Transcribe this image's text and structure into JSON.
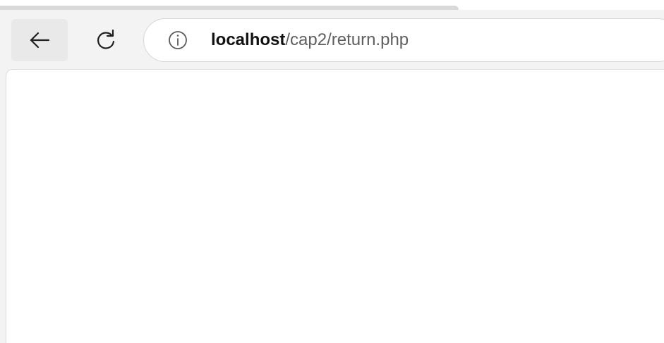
{
  "browser": {
    "nav": {
      "back_icon": "back-arrow-icon",
      "reload_icon": "reload-icon"
    },
    "address_bar": {
      "site_info_icon": "info-icon",
      "url_host": "localhost",
      "url_path": "/cap2/return.php"
    }
  },
  "page": {
    "content": ""
  },
  "colors": {
    "chrome_background": "#f3f3f3",
    "address_bar_background": "#ffffff",
    "host_text": "#111111",
    "path_text": "#5f5f5f"
  }
}
